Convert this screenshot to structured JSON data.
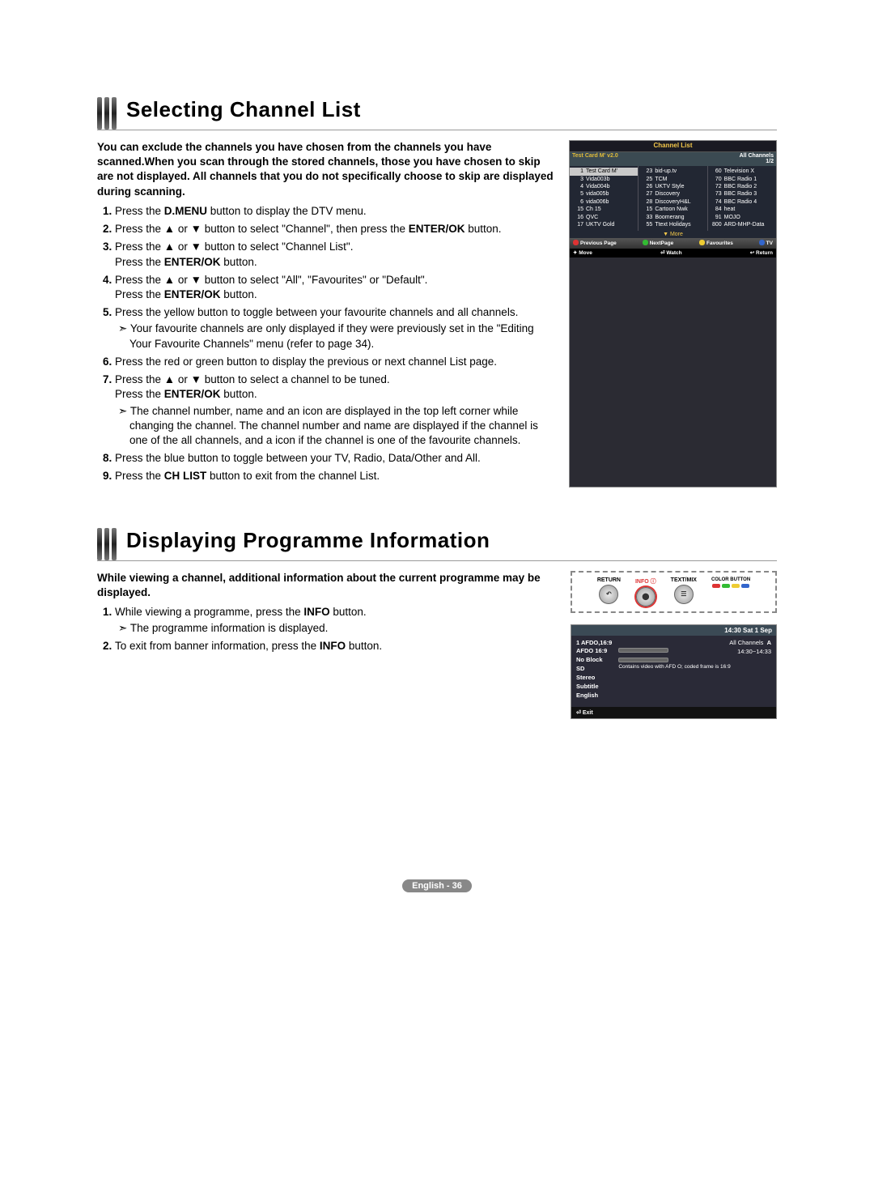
{
  "section1": {
    "title": "Selecting Channel List",
    "intro": "You can exclude the channels you have chosen from the channels you have scanned.When you scan through the stored channels, those you have chosen to skip are not displayed. All channels that you do not specifically choose to skip are displayed during scanning.",
    "steps": {
      "s1a": "Press the ",
      "s1b": "D.MENU",
      "s1c": " button to display the DTV menu.",
      "s2a": "Press the ▲ or ▼ button to select \"Channel\", then press the ",
      "s2b": "ENTER/OK",
      "s2c": " button.",
      "s3a": "Press the ▲ or ▼ button to select \"Channel List\".",
      "s3b": "Press the ",
      "s3c": "ENTER/OK",
      "s3d": " button.",
      "s4a": "Press the ▲ or ▼ button to select \"All\", \"Favourites\" or \"Default\".",
      "s4b": "Press the ",
      "s4c": "ENTER/OK",
      "s4d": " button.",
      "s5a": "Press the yellow button to toggle between your favourite channels and all channels.",
      "s5sub": "Your favourite channels are only displayed if they were previously set in the \"Editing Your Favourite Channels\" menu (refer to page 34).",
      "s6": "Press the red or green button to display the previous or next channel List page.",
      "s7a": "Press the ▲ or ▼ button to select a channel to be tuned.",
      "s7b": "Press the ",
      "s7c": "ENTER/OK",
      "s7d": " button.",
      "s7sub": "The channel number, name and an icon are displayed in the top left corner while changing the channel. The channel number and name are displayed if the channel is one of the all channels, and a  icon if the channel is one of the favourite channels.",
      "s8": "Press the blue button to toggle between your TV, Radio, Data/Other and All.",
      "s9a": "Press the ",
      "s9b": "CH LIST",
      "s9c": " button to exit from the channel List."
    },
    "osd": {
      "title": "Channel List",
      "meta_left": "Test Card M' v2.0",
      "meta_right1": "All Channels",
      "meta_right2": "1/2",
      "col1": [
        {
          "n": "1",
          "t": "Test Card M'",
          "hl": true
        },
        {
          "n": "3",
          "t": "Vida003b"
        },
        {
          "n": "4",
          "t": "Vida004b"
        },
        {
          "n": "5",
          "t": "vida005b"
        },
        {
          "n": "6",
          "t": "vida006b"
        },
        {
          "n": "15",
          "t": "Ch 15"
        },
        {
          "n": "16",
          "t": "QVC"
        },
        {
          "n": "17",
          "t": "UKTV Gold"
        }
      ],
      "col2": [
        {
          "n": "23",
          "t": "bid-up.tv"
        },
        {
          "n": "25",
          "t": "TCM"
        },
        {
          "n": "26",
          "t": "UKTV Style"
        },
        {
          "n": "27",
          "t": "Discovery"
        },
        {
          "n": "28",
          "t": "DiscoveryH&L"
        },
        {
          "n": "15",
          "t": "Cartoon Nwk"
        },
        {
          "n": "33",
          "t": "Boomerang"
        },
        {
          "n": "55",
          "t": "Ttext Holidays"
        }
      ],
      "col3": [
        {
          "n": "60",
          "t": "Television X"
        },
        {
          "n": "70",
          "t": "BBC Radio 1"
        },
        {
          "n": "72",
          "t": "BBC Radio 2"
        },
        {
          "n": "73",
          "t": "BBC Radio 3"
        },
        {
          "n": "74",
          "t": "BBC Radio 4"
        },
        {
          "n": "84",
          "t": "heat"
        },
        {
          "n": "91",
          "t": "MOJO"
        },
        {
          "n": "800",
          "t": "ARD-MHP-Data"
        }
      ],
      "more": "▼ More",
      "legend1": {
        "a": "Previous Page",
        "b": "NextPage",
        "c": "Favourites",
        "d": "TV"
      },
      "legend2": {
        "a": "Move",
        "b": "Watch",
        "c": "Return"
      }
    }
  },
  "section2": {
    "title": "Displaying Programme Information",
    "intro": "While viewing a channel, additional information about the current programme may be displayed.",
    "steps": {
      "s1a": "While viewing a programme, press the ",
      "s1b": "INFO",
      "s1c": " button.",
      "s1sub": "The programme information is displayed.",
      "s2a": "To exit from banner information, press the ",
      "s2b": "INFO",
      "s2c": " button."
    },
    "remote": {
      "a": "RETURN",
      "b": "INFO",
      "c": "TEXT/MIX",
      "d": "COLOR BUTTON"
    },
    "info": {
      "time": "14:30 Sat 1 Sep",
      "left": [
        "1 AFDO,16:9",
        "AFDO 16:9",
        "No Block",
        "SD",
        "Stereo",
        "Subtitle",
        "English"
      ],
      "right_top1": "All Channels",
      "right_top2": "A",
      "right_time": "14:30~14:33",
      "desc": "Contains video with AFD O; coded frame is 16:9",
      "foot": "Exit"
    }
  },
  "pagenum": "English - 36"
}
